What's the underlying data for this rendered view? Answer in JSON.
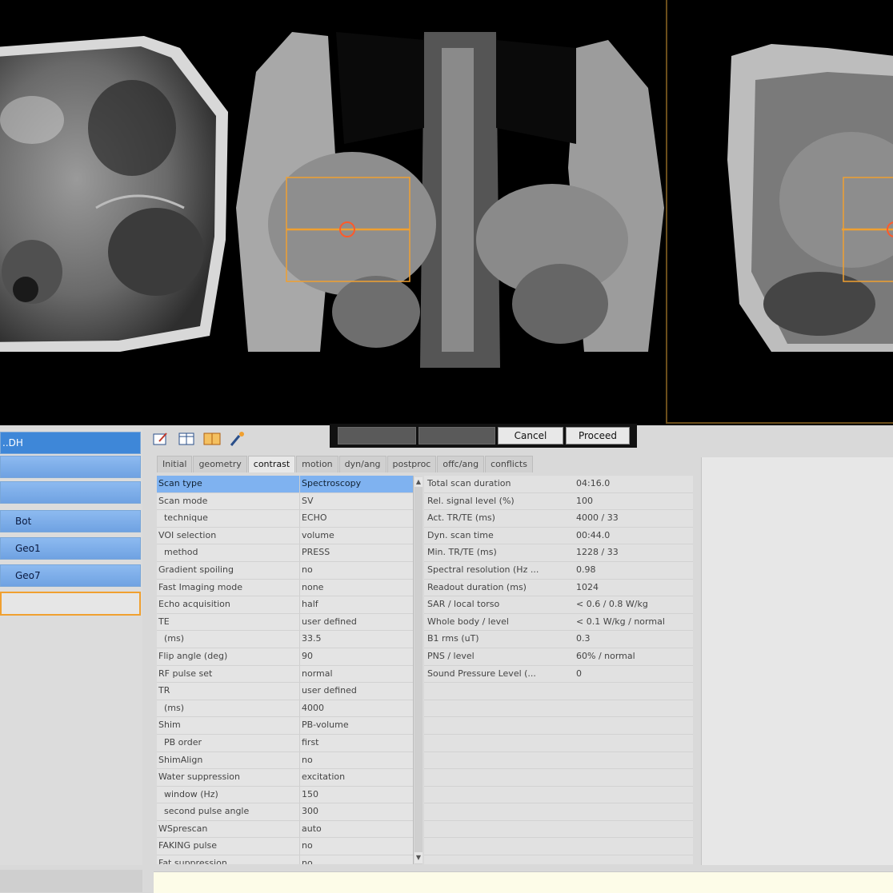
{
  "viewers": {
    "axial": {
      "label": "axial MR slice"
    },
    "coronal": {
      "label": "coronal MR slice"
    },
    "sagittal": {
      "label": "sagittal MR slice"
    },
    "voi_color": "#f0a030",
    "voi_marker_color": "#ff5a2a"
  },
  "left_list": {
    "items": [
      {
        "label": "..DH",
        "state": "selected"
      },
      {
        "label": "",
        "state": "normal"
      },
      {
        "label": "",
        "state": "normal"
      },
      {
        "label": "Bot",
        "state": "normal"
      },
      {
        "label": "Geo1",
        "state": "normal"
      },
      {
        "label": "Geo7",
        "state": "normal"
      },
      {
        "label": "",
        "state": "orange"
      }
    ]
  },
  "toolbar": {
    "icons": [
      "scan-edit-icon",
      "table-icon",
      "book-icon",
      "wand-icon"
    ]
  },
  "buttons": {
    "disabled1": "",
    "disabled2": "",
    "cancel": "Cancel",
    "proceed": "Proceed"
  },
  "tabs": [
    {
      "label": "Initial",
      "active": false
    },
    {
      "label": "geometry",
      "active": false
    },
    {
      "label": "contrast",
      "active": true
    },
    {
      "label": "motion",
      "active": false
    },
    {
      "label": "dyn/ang",
      "active": false
    },
    {
      "label": "postproc",
      "active": false
    },
    {
      "label": "offc/ang",
      "active": false
    },
    {
      "label": "conflicts",
      "active": false
    }
  ],
  "parameters": [
    {
      "name": "Scan type",
      "value": "Spectroscopy"
    },
    {
      "name": "Scan mode",
      "value": "SV"
    },
    {
      "name": "  technique",
      "value": "ECHO"
    },
    {
      "name": "VOI selection",
      "value": "volume"
    },
    {
      "name": "  method",
      "value": "PRESS"
    },
    {
      "name": "Gradient spoiling",
      "value": "no"
    },
    {
      "name": "Fast Imaging mode",
      "value": "none"
    },
    {
      "name": "Echo acquisition",
      "value": "half"
    },
    {
      "name": "TE",
      "value": "user defined"
    },
    {
      "name": "  (ms)",
      "value": "33.5"
    },
    {
      "name": "Flip angle (deg)",
      "value": "90"
    },
    {
      "name": "RF pulse set",
      "value": "normal"
    },
    {
      "name": "TR",
      "value": "user defined"
    },
    {
      "name": "  (ms)",
      "value": "4000"
    },
    {
      "name": "Shim",
      "value": "PB-volume"
    },
    {
      "name": "  PB order",
      "value": "first"
    },
    {
      "name": "ShimAlign",
      "value": "no"
    },
    {
      "name": "Water suppression",
      "value": "excitation"
    },
    {
      "name": "  window (Hz)",
      "value": "150"
    },
    {
      "name": "  second pulse angle",
      "value": "300"
    },
    {
      "name": "WSprescan",
      "value": "auto"
    },
    {
      "name": "FAKING pulse",
      "value": "no"
    },
    {
      "name": "Fat suppression",
      "value": "no"
    }
  ],
  "info": [
    {
      "name": "Total scan duration",
      "value": "04:16.0"
    },
    {
      "name": "Rel. signal level (%)",
      "value": "100"
    },
    {
      "name": "Act. TR/TE (ms)",
      "value": "4000 / 33"
    },
    {
      "name": "Dyn. scan time",
      "value": "00:44.0"
    },
    {
      "name": "Min. TR/TE (ms)",
      "value": "1228 / 33"
    },
    {
      "name": "Spectral resolution (Hz ...",
      "value": "0.98"
    },
    {
      "name": "Readout duration (ms)",
      "value": "1024"
    },
    {
      "name": "SAR / local torso",
      "value": "< 0.6 / 0.8 W/kg"
    },
    {
      "name": "Whole body / level",
      "value": "< 0.1 W/kg / normal"
    },
    {
      "name": "B1 rms (uT)",
      "value": "0.3"
    },
    {
      "name": "PNS / level",
      "value": "60% / normal"
    },
    {
      "name": "Sound Pressure Level (...",
      "value": "0"
    },
    {
      "name": "",
      "value": ""
    },
    {
      "name": "",
      "value": ""
    },
    {
      "name": "",
      "value": ""
    },
    {
      "name": "",
      "value": ""
    },
    {
      "name": "",
      "value": ""
    },
    {
      "name": "",
      "value": ""
    },
    {
      "name": "",
      "value": ""
    },
    {
      "name": "",
      "value": ""
    },
    {
      "name": "",
      "value": ""
    },
    {
      "name": "",
      "value": ""
    },
    {
      "name": "",
      "value": ""
    }
  ],
  "status_text": ""
}
